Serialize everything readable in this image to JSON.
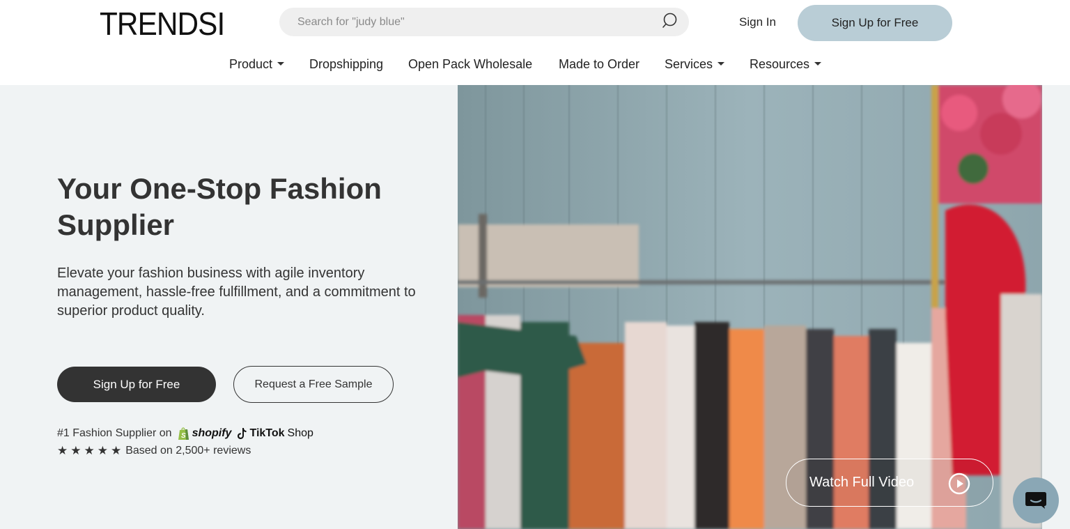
{
  "header": {
    "logo": "TRENDSI",
    "search_placeholder": "Search for \"judy blue\"",
    "sign_in": "Sign In",
    "sign_up": "Sign Up for Free"
  },
  "nav": {
    "items": [
      {
        "label": "Product",
        "dropdown": true
      },
      {
        "label": "Dropshipping",
        "dropdown": false
      },
      {
        "label": "Open Pack Wholesale",
        "dropdown": false
      },
      {
        "label": "Made to Order",
        "dropdown": false
      },
      {
        "label": "Services",
        "dropdown": true
      },
      {
        "label": "Resources",
        "dropdown": true
      }
    ]
  },
  "hero": {
    "title": "Your One-Stop Fashion Supplier",
    "description": "Elevate your fashion business with agile inventory management, hassle-free fulfillment, and a commitment to superior product quality.",
    "primary_cta": "Sign Up for Free",
    "secondary_cta": "Request a Free Sample",
    "supplier_text": "#1 Fashion Supplier on",
    "shopify_label": "shopify",
    "tiktok_label": "TikTok",
    "tiktok_shop_label": "Shop",
    "stars": "★★★★★",
    "rating_count": 5,
    "reviews_text": "Based on 2,500+ reviews",
    "watch_video": "Watch Full Video"
  },
  "colors": {
    "accent_signup": "#b9cdd6",
    "dark_button": "#333333",
    "hero_bg": "#f0f3f4",
    "chat_button": "#8aa7b5"
  },
  "icons": {
    "search": "search-icon",
    "play": "play-circle-icon",
    "chat": "chat-bubble-icon",
    "caret": "caret-down-icon"
  }
}
